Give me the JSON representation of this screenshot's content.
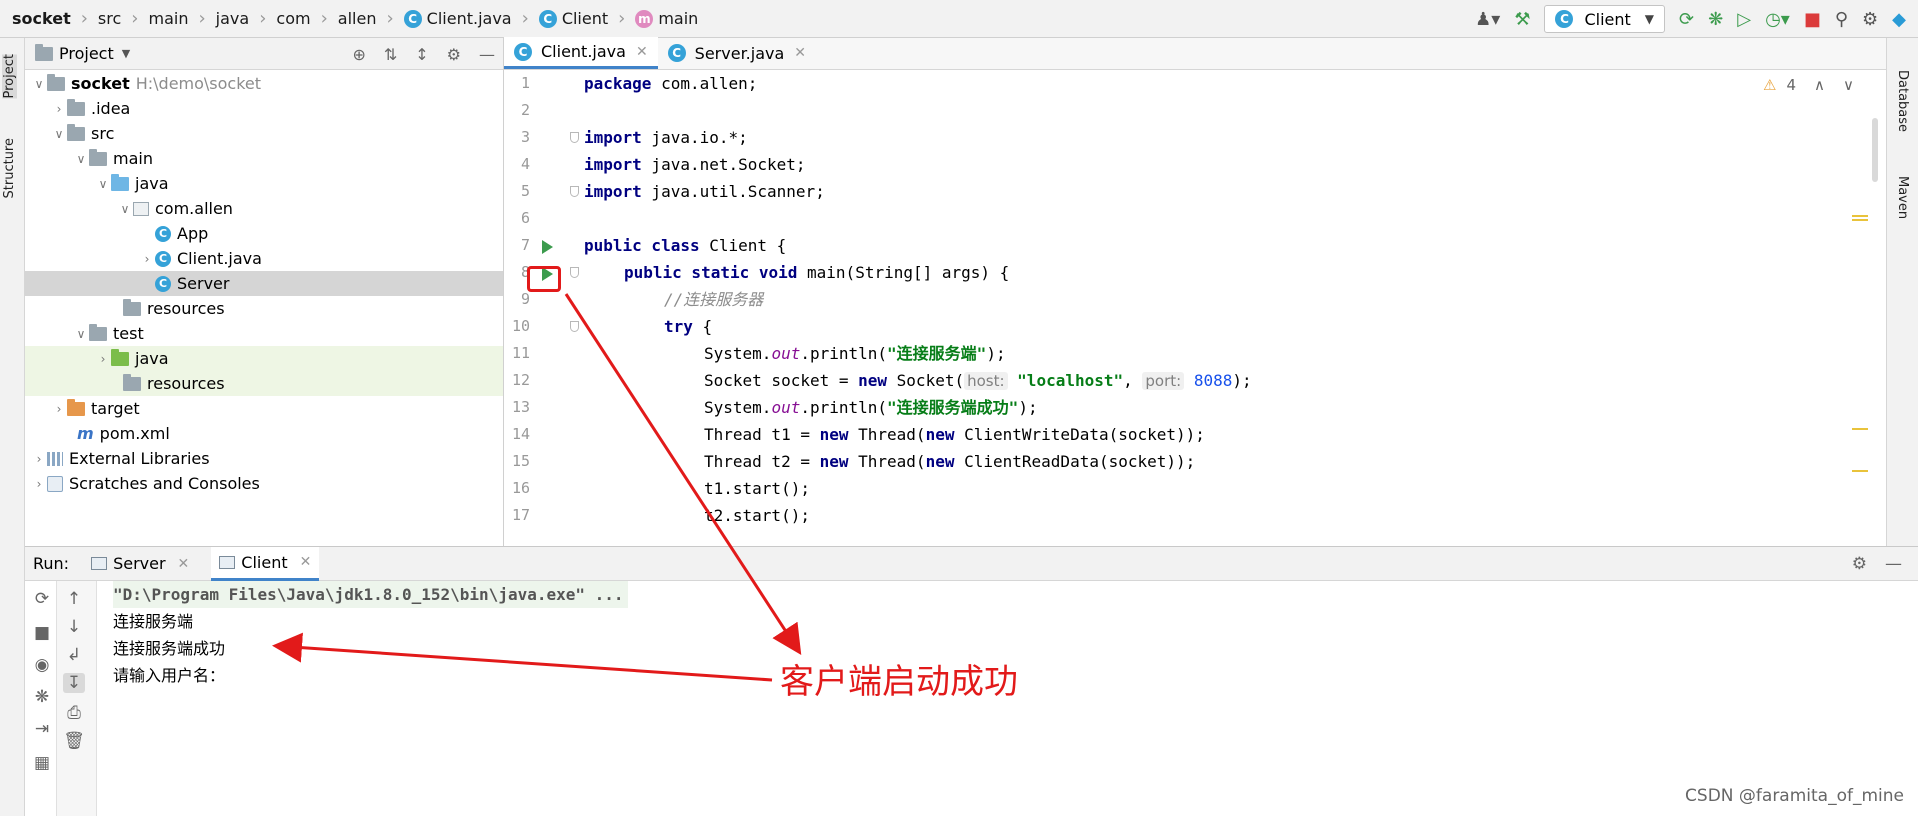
{
  "breadcrumb": [
    "socket",
    "src",
    "main",
    "java",
    "com",
    "allen",
    "Client.java",
    "Client",
    "main"
  ],
  "run_config": "Client",
  "left_tabs": [
    "Project",
    "Structure"
  ],
  "right_tabs": [
    "Database",
    "Maven"
  ],
  "project": {
    "title": "Project",
    "root_name": "socket",
    "root_path": "H:\\demo\\socket",
    "items": {
      "idea": ".idea",
      "src": "src",
      "main": "main",
      "java": "java",
      "pkg": "com.allen",
      "app": "App",
      "client": "Client.java",
      "server": "Server",
      "resources": "resources",
      "test": "test",
      "test_java": "java",
      "test_resources": "resources",
      "target": "target",
      "pom": "pom.xml",
      "ext_libs": "External Libraries",
      "scratches": "Scratches and Consoles"
    }
  },
  "editor": {
    "tabs": [
      "Client.java",
      "Server.java"
    ],
    "line_numbers": [
      "1",
      "2",
      "3",
      "4",
      "5",
      "6",
      "7",
      "8",
      "9",
      "10",
      "11",
      "12",
      "13",
      "14",
      "15",
      "16",
      "17"
    ],
    "inspection_count": "4",
    "code": {
      "l1_kw": "package",
      "l1_rest": " com.allen;",
      "l3_kw": "import",
      "l3_rest": " java.io.*;",
      "l4_kw": "import",
      "l4_rest": " java.net.Socket;",
      "l5_kw": "import",
      "l5_rest": " java.util.Scanner;",
      "l7_kw": "public class",
      "l7_rest": " Client {",
      "l8_kw": "public static void",
      "l8_rest": " main(String[] args) {",
      "l9_comment": "//连接服务器",
      "l10_kw": "try",
      "l10_rest": " {",
      "l11_a": "System.",
      "l11_field": "out",
      "l11_b": ".println(",
      "l11_str": "\"连接服务端\"",
      "l11_c": ");",
      "l12_a": "Socket socket = ",
      "l12_kw": "new",
      "l12_b": " Socket(",
      "l12_hint1": "host:",
      "l12_str": "\"localhost\"",
      "l12_c": ", ",
      "l12_hint2": "port:",
      "l12_num": "8088",
      "l12_d": ");",
      "l13_a": "System.",
      "l13_field": "out",
      "l13_b": ".println(",
      "l13_str": "\"连接服务端成功\"",
      "l13_c": ");",
      "l14_a": "Thread t1 = ",
      "l14_kw1": "new",
      "l14_b": " Thread(",
      "l14_kw2": "new",
      "l14_c": " ClientWriteData(socket));",
      "l15_a": "Thread t2 = ",
      "l15_kw1": "new",
      "l15_b": " Thread(",
      "l15_kw2": "new",
      "l15_c": " ClientReadData(socket));",
      "l16": "t1.start();",
      "l17": "t2.start();"
    }
  },
  "run": {
    "label": "Run:",
    "tabs": [
      "Server",
      "Client"
    ],
    "console": [
      "\"D:\\Program Files\\Java\\jdk1.8.0_152\\bin\\java.exe\" ...",
      "连接服务端",
      "连接服务端成功",
      "请输入用户名："
    ]
  },
  "annotation": "客户端启动成功",
  "watermark": "CSDN @faramita_of_mine",
  "colors": {
    "accent": "#4083c9",
    "run_green": "#3c9b4d",
    "annotation_red": "#e21a1a",
    "keyword": "#000080",
    "string": "#067d17"
  },
  "icons": [
    "play-icon",
    "hammer-icon",
    "rerun-icon",
    "debug-icon",
    "stop-icon",
    "search-icon",
    "gear-icon",
    "close-icon",
    "warning-icon"
  ]
}
